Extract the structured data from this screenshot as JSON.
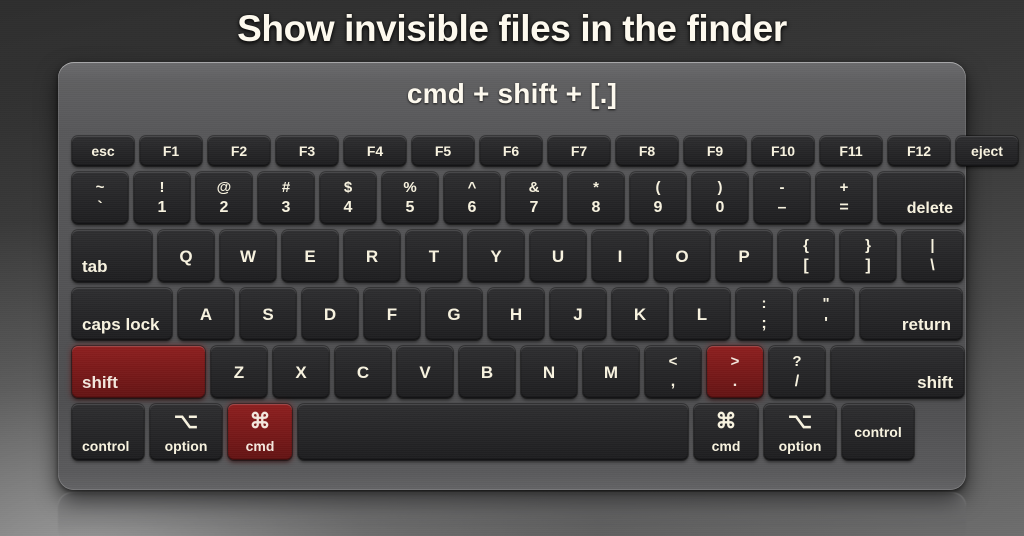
{
  "title": "Show invisible files in the finder",
  "shortcut": "cmd + shift + [.]",
  "colors": {
    "highlight": "#7e1b1b",
    "key": "#28282a",
    "body": "#58585a",
    "text": "#f7f2df"
  },
  "rows": {
    "fn": [
      {
        "label": "esc",
        "cls": "k-esc",
        "align": "center"
      },
      {
        "label": "F1",
        "cls": "k-fn"
      },
      {
        "label": "F2",
        "cls": "k-fn"
      },
      {
        "label": "F3",
        "cls": "k-fn"
      },
      {
        "label": "F4",
        "cls": "k-fn"
      },
      {
        "label": "F5",
        "cls": "k-fn"
      },
      {
        "label": "F6",
        "cls": "k-fn"
      },
      {
        "label": "F7",
        "cls": "k-fn"
      },
      {
        "label": "F8",
        "cls": "k-fn"
      },
      {
        "label": "F9",
        "cls": "k-fn"
      },
      {
        "label": "F10",
        "cls": "k-fn"
      },
      {
        "label": "F11",
        "cls": "k-fn"
      },
      {
        "label": "F12",
        "cls": "k-fn"
      },
      {
        "label": "eject",
        "cls": "k-eject"
      }
    ],
    "num": [
      {
        "top": "~",
        "bottom": "`",
        "cls": "k-num"
      },
      {
        "top": "!",
        "bottom": "1",
        "cls": "k-num"
      },
      {
        "top": "@",
        "bottom": "2",
        "cls": "k-num"
      },
      {
        "top": "#",
        "bottom": "3",
        "cls": "k-num"
      },
      {
        "top": "$",
        "bottom": "4",
        "cls": "k-num"
      },
      {
        "top": "%",
        "bottom": "5",
        "cls": "k-num"
      },
      {
        "top": "^",
        "bottom": "6",
        "cls": "k-num"
      },
      {
        "top": "&",
        "bottom": "7",
        "cls": "k-num"
      },
      {
        "top": "*",
        "bottom": "8",
        "cls": "k-num"
      },
      {
        "top": "(",
        "bottom": "9",
        "cls": "k-num"
      },
      {
        "top": ")",
        "bottom": "0",
        "cls": "k-num"
      },
      {
        "top": "-",
        "bottom": "–",
        "cls": "k-num"
      },
      {
        "top": "+",
        "bottom": "=",
        "cls": "k-num"
      },
      {
        "label": "delete",
        "cls": "k-delete",
        "align": "br"
      }
    ],
    "qwer": [
      {
        "label": "tab",
        "cls": "k-tab",
        "align": "bl"
      },
      {
        "label": "Q",
        "cls": "k-alpha"
      },
      {
        "label": "W",
        "cls": "k-alpha"
      },
      {
        "label": "E",
        "cls": "k-alpha"
      },
      {
        "label": "R",
        "cls": "k-alpha"
      },
      {
        "label": "T",
        "cls": "k-alpha"
      },
      {
        "label": "Y",
        "cls": "k-alpha"
      },
      {
        "label": "U",
        "cls": "k-alpha"
      },
      {
        "label": "I",
        "cls": "k-alpha"
      },
      {
        "label": "O",
        "cls": "k-alpha"
      },
      {
        "label": "P",
        "cls": "k-alpha"
      },
      {
        "top": "{",
        "bottom": "[",
        "cls": "k-alpha"
      },
      {
        "top": "}",
        "bottom": "]",
        "cls": "k-alpha"
      },
      {
        "top": "|",
        "bottom": "\\",
        "cls": "k-bsl"
      }
    ],
    "asdf": [
      {
        "label": "caps lock",
        "cls": "k-caps",
        "align": "bl"
      },
      {
        "label": "A",
        "cls": "k-alpha"
      },
      {
        "label": "S",
        "cls": "k-alpha"
      },
      {
        "label": "D",
        "cls": "k-alpha"
      },
      {
        "label": "F",
        "cls": "k-alpha"
      },
      {
        "label": "G",
        "cls": "k-alpha"
      },
      {
        "label": "H",
        "cls": "k-alpha"
      },
      {
        "label": "J",
        "cls": "k-alpha"
      },
      {
        "label": "K",
        "cls": "k-alpha"
      },
      {
        "label": "L",
        "cls": "k-alpha"
      },
      {
        "top": ":",
        "bottom": ";",
        "cls": "k-alpha"
      },
      {
        "top": "\"",
        "bottom": "'",
        "cls": "k-alpha"
      },
      {
        "label": "return",
        "cls": "k-return",
        "align": "br"
      }
    ],
    "zxcv": [
      {
        "label": "shift",
        "cls": "k-lshift",
        "align": "bl",
        "highlight": true
      },
      {
        "label": "Z",
        "cls": "k-alpha"
      },
      {
        "label": "X",
        "cls": "k-alpha"
      },
      {
        "label": "C",
        "cls": "k-alpha"
      },
      {
        "label": "V",
        "cls": "k-alpha"
      },
      {
        "label": "B",
        "cls": "k-alpha"
      },
      {
        "label": "N",
        "cls": "k-alpha"
      },
      {
        "label": "M",
        "cls": "k-alpha"
      },
      {
        "top": "<",
        "bottom": ",",
        "cls": "k-alpha"
      },
      {
        "top": ">",
        "bottom": ".",
        "cls": "k-alpha",
        "highlight": true
      },
      {
        "top": "?",
        "bottom": "/",
        "cls": "k-alpha"
      },
      {
        "label": "shift",
        "cls": "k-rshift",
        "align": "br"
      }
    ],
    "mod": [
      {
        "label": "control",
        "cls": "k-ctrl",
        "align": "bl"
      },
      {
        "glyph": "⌥",
        "sub": "option",
        "cls": "k-opt",
        "icon": "option-icon"
      },
      {
        "glyph": "⌘",
        "sub": "cmd",
        "cls": "k-cmd",
        "highlight": true,
        "icon": "command-icon"
      },
      {
        "label": "",
        "cls": "k-space",
        "name": "spacebar"
      },
      {
        "glyph": "⌘",
        "sub": "cmd",
        "cls": "k-cmd",
        "icon": "command-icon"
      },
      {
        "glyph": "⌥",
        "sub": "option",
        "cls": "k-opt",
        "icon": "option-icon"
      },
      {
        "label": "control",
        "cls": "k-ctrl"
      }
    ]
  }
}
